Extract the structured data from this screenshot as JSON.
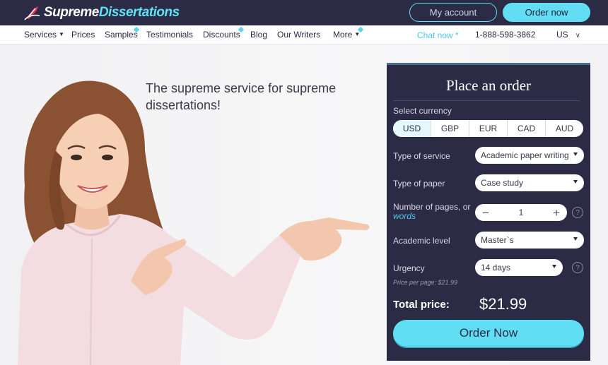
{
  "header": {
    "logo_part1": "Supreme",
    "logo_part2": "Dissertations",
    "my_account": "My account",
    "order_now": "Order now"
  },
  "nav": {
    "services": "Services",
    "prices": "Prices",
    "samples": "Samples",
    "testimonials": "Testimonials",
    "discounts": "Discounts",
    "blog": "Blog",
    "our_writers": "Our Writers",
    "more": "More",
    "chat": "Chat now *",
    "phone": "1-888-598-3862",
    "country": "US"
  },
  "hero": {
    "headline": "The supreme service for supreme dissertations!"
  },
  "order": {
    "title": "Place an order",
    "currency_label": "Select currency",
    "currencies": [
      "USD",
      "GBP",
      "EUR",
      "CAD",
      "AUD"
    ],
    "selected_currency": "USD",
    "service_label": "Type of service",
    "service_value": "Academic paper writing",
    "paper_label": "Type of paper",
    "paper_value": "Case study",
    "pages_label": "Number of pages, or",
    "pages_words": "words",
    "pages_value": "1",
    "level_label": "Academic level",
    "level_value": "Master`s",
    "urgency_label": "Urgency",
    "urgency_value": "14 days",
    "price_per_page": "Price per page:  $21.99",
    "total_label": "Total price:",
    "total_value": "$21.99",
    "order_button": "Order Now",
    "help": "?"
  },
  "colors": {
    "dark": "#2c2b45",
    "accent": "#5fe2f5"
  }
}
